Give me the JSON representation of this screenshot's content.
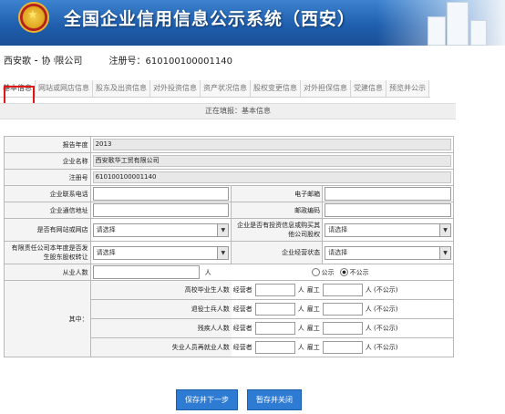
{
  "header": {
    "title": "全国企业信用信息公示系统（西安）"
  },
  "company": {
    "name": "西安歌 ⁃ 协 ᵎ限公司",
    "reg_label": "注册号：610100100001140"
  },
  "tabs": [
    {
      "label": "基本信息",
      "active": true
    },
    {
      "label": "网站或网店信息"
    },
    {
      "label": "股东及出资信息"
    },
    {
      "label": "对外投资信息"
    },
    {
      "label": "资产状况信息"
    },
    {
      "label": "股权变更信息"
    },
    {
      "label": "对外担保信息"
    },
    {
      "label": "党建信息"
    },
    {
      "label": "预览并公示"
    }
  ],
  "filing_status": "正在填报：基本信息",
  "form": {
    "report_year_label": "报告年度",
    "report_year": "2013",
    "company_name_label": "企业名称",
    "company_name": "西安歌华工贸有限公司",
    "reg_no_label": "注册号",
    "reg_no": "610100100001140",
    "phone_label": "企业联系电话",
    "email_label": "电子邮箱",
    "address_label": "企业通信地址",
    "postcode_label": "邮政编码",
    "website_label": "是否有网站或网店",
    "website_value": "请选择",
    "invest_label": "企业是否有投资信息或购买其他公司股权",
    "invest_value": "请选择",
    "transfer_label": "有限责任公司本年度是否发生股东股权转让",
    "transfer_value": "请选择",
    "status_label": "企业经营状态",
    "status_value": "请选择",
    "employees_label": "从业人数",
    "employees_unit": "人",
    "public_label": "公示",
    "not_public_label": "不公示",
    "details_label": "其中：",
    "emp_rows": [
      {
        "label": "高校毕业生人数"
      },
      {
        "label": "退役士兵人数"
      },
      {
        "label": "残疾人人数"
      },
      {
        "label": "失业人员再就业人数"
      }
    ],
    "owner_label": "经营者",
    "employee_label": "雇工",
    "person_unit": "人",
    "hidden_label": "人 (不公示)"
  },
  "buttons": {
    "save_next": "保存并下一步",
    "save_close": "暂存并关闭"
  }
}
